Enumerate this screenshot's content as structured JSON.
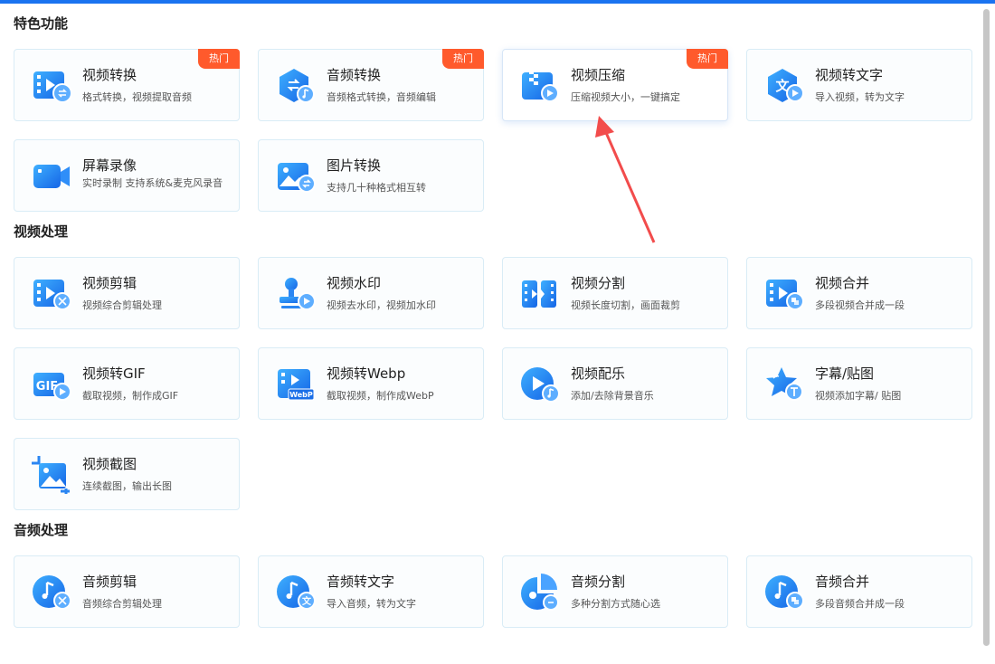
{
  "sections": [
    {
      "title": "特色功能"
    },
    {
      "title": "视频处理"
    },
    {
      "title": "音频处理"
    }
  ],
  "tools": [
    {
      "name": "视频转换",
      "desc": "格式转换，视频提取音频",
      "badge": "热门",
      "icon": "video-convert-icon"
    },
    {
      "name": "音频转换",
      "desc": "音频格式转换，音频编辑",
      "badge": "热门",
      "icon": "audio-convert-icon"
    },
    {
      "name": "视频压缩",
      "desc": "压缩视频大小，一键搞定",
      "badge": "热门",
      "icon": "video-compress-icon"
    },
    {
      "name": "视频转文字",
      "desc": "导入视频，转为文字",
      "icon": "video-to-text-icon"
    },
    {
      "name": "屏幕录像",
      "desc": "实时录制 支持系统&麦克风录音",
      "icon": "screen-record-icon"
    },
    {
      "name": "图片转换",
      "desc": "支持几十种格式相互转",
      "icon": "image-convert-icon"
    },
    {
      "name": "视频剪辑",
      "desc": "视频综合剪辑处理",
      "icon": "video-edit-icon"
    },
    {
      "name": "视频水印",
      "desc": "视频去水印，视频加水印",
      "icon": "video-watermark-icon"
    },
    {
      "name": "视频分割",
      "desc": "视频长度切割，画面裁剪",
      "icon": "video-split-icon"
    },
    {
      "name": "视频合并",
      "desc": "多段视频合并成一段",
      "icon": "video-merge-icon"
    },
    {
      "name": "视频转GIF",
      "desc": "截取视频，制作成GIF",
      "icon": "video-to-gif-icon",
      "icon_text": "GIF"
    },
    {
      "name": "视频转Webp",
      "desc": "截取视频，制作成WebP",
      "icon": "video-to-webp-icon",
      "icon_text": "WebP"
    },
    {
      "name": "视频配乐",
      "desc": "添加/去除背景音乐",
      "icon": "video-music-icon"
    },
    {
      "name": "字幕/贴图",
      "desc": "视频添加字幕/ 贴图",
      "icon": "subtitle-sticker-icon"
    },
    {
      "name": "视频截图",
      "desc": "连续截图，输出长图",
      "icon": "video-screenshot-icon"
    },
    {
      "name": "音频剪辑",
      "desc": "音频综合剪辑处理",
      "icon": "audio-edit-icon"
    },
    {
      "name": "音频转文字",
      "desc": "导入音频，转为文字",
      "icon": "audio-to-text-icon",
      "icon_text": "文"
    },
    {
      "name": "音频分割",
      "desc": "多种分割方式随心选",
      "icon": "audio-split-icon"
    },
    {
      "name": "音频合并",
      "desc": "多段音频合并成一段",
      "icon": "audio-merge-icon"
    }
  ],
  "colors": {
    "accent": "#1a73f0",
    "icon_blue": "#1e88f5",
    "badge": "#ff5a2c",
    "arrow": "#f24c4c"
  }
}
